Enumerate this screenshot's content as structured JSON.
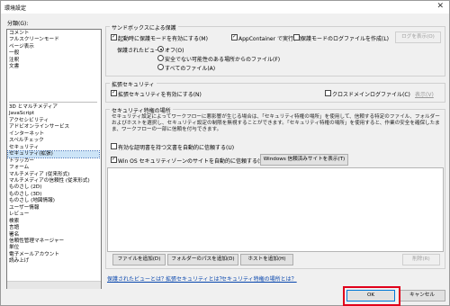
{
  "window": {
    "title": "環境設定",
    "close_glyph": "✕"
  },
  "categories_label": "分類(G):",
  "categories_top": [
    "コメント",
    "フルスクリーンモード",
    "ページ表示",
    "一般",
    "注釈",
    "文書"
  ],
  "categories_bottom": [
    "3D とマルチメディア",
    "JavaScript",
    "アクセシビリティ",
    "アドビオンラインサービス",
    "インターネット",
    "スペルチェック",
    "セキュリティ",
    "セキュリティ(拡張)",
    "トラッカー",
    "フォーム",
    "マルチメディア (従来形式)",
    "マルチメディアの信頼性 (従来形式)",
    "ものさし (2D)",
    "ものさし (3D)",
    "ものさし (地図情報)",
    "ユーザー情報",
    "レビュー",
    "検索",
    "言語",
    "署名",
    "信頼性管理マネージャー",
    "単位",
    "電子メールアカウント",
    "読み上げ"
  ],
  "selected_category": "セキュリティ(拡張)",
  "sandbox": {
    "title": "サンドボックスによる保護",
    "protected_mode": "起動時に保護モードを有効にする(M)",
    "appcontainer": "AppContainer で実行(U)",
    "log": "保護モードのログファイルを作成(L)",
    "view_log": "ログを表示(O)",
    "protected_view_label": "保護されたビュー:",
    "options": [
      "オフ(O)",
      "安全でない可能性のある場所からのファイル(F)",
      "すべてのファイル(A)"
    ]
  },
  "enhanced": {
    "title": "拡張セキュリティ",
    "enable": "拡張セキュリティを有効にする(N)",
    "cross_domain": "クロスドメインログファイル(C)",
    "view": "表示(V)"
  },
  "privileged": {
    "title": "セキュリティ特権の場所",
    "description": "セキュリティ設定によってワークフローに悪影響が生じる場合は、「セキュリティ特権の場所」を使用して、信頼する特定のファイル、フォルダー およびホストを選択し、セキュリティ設定の制限を無視することができます。「セキュリティ特権の場所」を使用すると、作業の安全を確保したまま、ワークフローの一部に信頼を付与できます。",
    "certified": "有効な証明書を持つ文書を自動的に信頼する(U)",
    "win_os": "Win OS セキュリティゾーンのサイトを自動的に信頼する(S)",
    "show_sites": "Windows 信頼済みサイトを表示(T)",
    "add_file": "ファイルを追加(D)",
    "add_folder": "フォルダーのパスを追加(D)",
    "add_host": "ホストを追加(H)",
    "remove": "削除(R)"
  },
  "links": [
    "保護されたビューとは？",
    "拡張セキュリティとは？",
    "セキュリティ特権の場所とは？"
  ],
  "footer": {
    "ok": "OK",
    "cancel": "キャンセル"
  }
}
